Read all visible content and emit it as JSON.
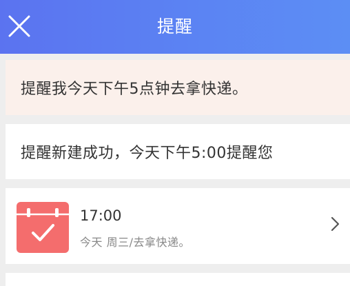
{
  "header": {
    "title": "提醒",
    "close_icon": "close-icon",
    "gradient_start": "#5b73f0",
    "gradient_end": "#5c8ef4"
  },
  "conversation": {
    "user_message": "提醒我今天下午5点钟去拿快递。",
    "assistant_response": "提醒新建成功，今天下午5:00提醒您"
  },
  "reminder": {
    "icon": "calendar-check-icon",
    "icon_color": "#f46d6d",
    "time": "17:00",
    "detail": "今天 周三/去拿快递。",
    "chevron_icon": "chevron-right-icon"
  }
}
